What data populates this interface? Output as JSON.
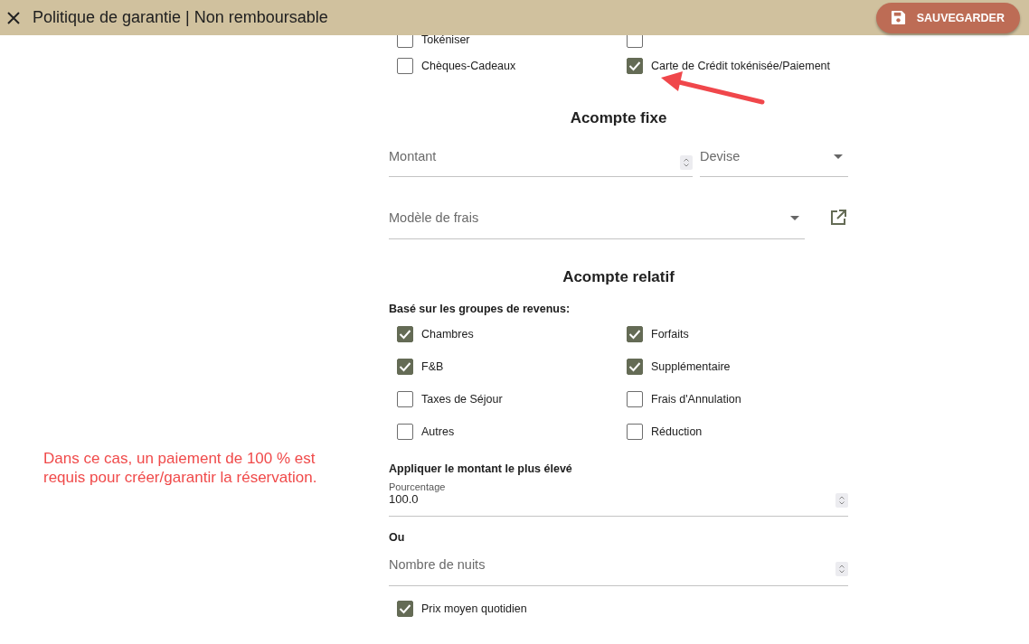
{
  "window": {
    "title": "Politique de garantie | Non remboursable",
    "save_button": "SAUVEGARDER"
  },
  "annotation": {
    "text": "Dans ce cas, un paiement de 100 % est requis pour créer/garantir la réservation."
  },
  "payment_methods_partial": [
    {
      "label": "Tokéniser",
      "checked": false
    },
    {
      "checked": false
    }
  ],
  "payment_methods": [
    {
      "label": "Chèques-Cadeaux",
      "checked": false
    },
    {
      "label": "Carte de Crédit tokénisée/Paiement",
      "checked": true
    }
  ],
  "fixed_deposit": {
    "title": "Acompte fixe",
    "amount": {
      "placeholder": "Montant"
    },
    "currency": {
      "placeholder": "Devise"
    },
    "fee_template": {
      "placeholder": "Modèle de frais"
    }
  },
  "relative_deposit": {
    "title": "Acompte relatif",
    "revenue_groups_label": "Basé sur les groupes de revenus:",
    "revenue_groups": [
      {
        "label": "Chambres",
        "checked": true
      },
      {
        "label": "Forfaits",
        "checked": true
      },
      {
        "label": "F&B",
        "checked": true
      },
      {
        "label": "Supplémentaire",
        "checked": true
      },
      {
        "label": "Taxes de Séjour",
        "checked": false
      },
      {
        "label": "Frais d'Annulation",
        "checked": false
      },
      {
        "label": "Autres",
        "checked": false
      },
      {
        "label": "Réduction",
        "checked": false
      }
    ],
    "apply_label": "Appliquer le montant le plus élevé",
    "percentage": {
      "label": "Pourcentage",
      "value": "100.0"
    },
    "or_label": "Ou",
    "nights": {
      "placeholder": "Nombre de nuits"
    },
    "average_daily_rate": {
      "label": "Prix moyen quotidien",
      "checked": true
    }
  }
}
